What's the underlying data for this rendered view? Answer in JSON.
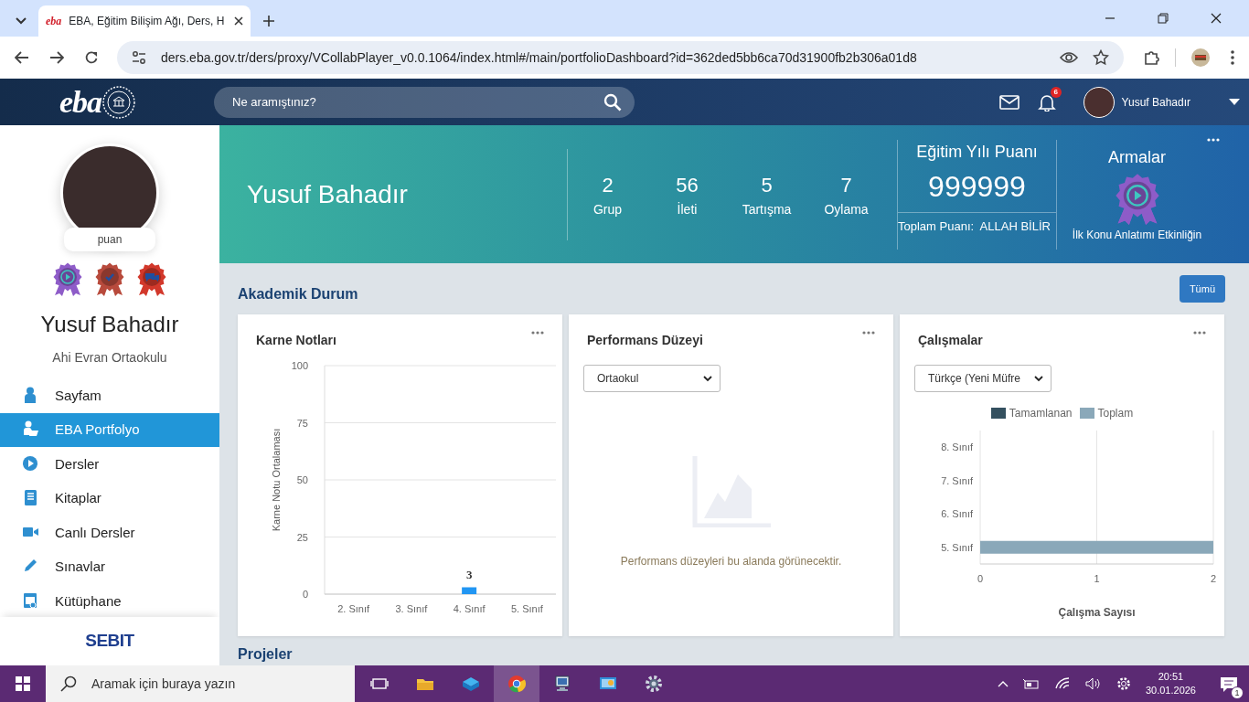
{
  "browser": {
    "favicon_text": "eba",
    "tab_title": "EBA, Eğitim Bilişim Ağı, Ders, H",
    "url": "ders.eba.gov.tr/ders/proxy/VCollabPlayer_v0.0.1064/index.html#/main/portfolioDashboard?id=362ded5bb6ca70d31900fb2b306a01d8"
  },
  "header": {
    "logo": "eba",
    "search": {
      "placeholder": "Ne aramıştınız?"
    },
    "notification_count": "6",
    "user_name": "Yusuf Bahadır"
  },
  "sidebar": {
    "points_label": "puan",
    "badges": [
      {
        "color": "#8e5cc8"
      },
      {
        "color": "#b84a3c"
      },
      {
        "color": "#d2382b"
      }
    ],
    "name": "Yusuf Bahadır",
    "school": "Ahi Evran Ortaokulu",
    "items": [
      {
        "label": "Sayfam",
        "selected": false
      },
      {
        "label": "EBA Portfolyo",
        "selected": true
      },
      {
        "label": "Dersler",
        "selected": false
      },
      {
        "label": "Kitaplar",
        "selected": false
      },
      {
        "label": "Canlı Dersler",
        "selected": false
      },
      {
        "label": "Sınavlar",
        "selected": false
      },
      {
        "label": "Kütüphane",
        "selected": false
      }
    ],
    "footer_logo": "SEBIT"
  },
  "banner": {
    "name": "Yusuf Bahadır",
    "stats": [
      {
        "value": "2",
        "label": "Grup"
      },
      {
        "value": "56",
        "label": "İleti"
      },
      {
        "value": "5",
        "label": "Tartışma"
      },
      {
        "value": "7",
        "label": "Oylama"
      }
    ],
    "year_points_title": "Eğitim Yılı Puanı",
    "year_points": "999999",
    "total_points": "Toplam Puanı:  ALLAH BİLİR",
    "emblems_title": "Armalar",
    "emblem_caption": "İlk Konu Anlatımı Etkinliğin"
  },
  "section": {
    "title": "Akademik Durum",
    "button": "Tümü"
  },
  "cards": [
    {
      "title": "Karne Notları",
      "kind": "chart",
      "chart_data": {
        "type": "bar",
        "ylabel": "Karne Notu Ortalaması",
        "categories": [
          "2. Sınıf",
          "3. Sınıf",
          "4. Sınıf",
          "5. Sınıf"
        ],
        "values": [
          null,
          null,
          3,
          null
        ],
        "grid": true,
        "ylim": [
          0,
          100
        ],
        "yticks": [
          0,
          25,
          50,
          75,
          100
        ],
        "data_labels": true
      }
    },
    {
      "title": "Performans Düzeyi",
      "kind": "empty",
      "select": "Ortaokul",
      "empty_text": "Performans düzeyleri bu alanda görünecektir."
    },
    {
      "title": "Çalışmalar",
      "kind": "chart",
      "select": "Türkçe (Yeni Müfre",
      "chart_data": {
        "type": "bar",
        "orientation": "horizontal",
        "xlabel": "Çalışma Sayısı",
        "categories": [
          "8. Sınıf",
          "7. Sınıf",
          "6. Sınıf",
          "5. Sınıf"
        ],
        "series": [
          {
            "name": "Tamamlanan",
            "color": "#34505f",
            "values": [
              0,
              0,
              0,
              0
            ]
          },
          {
            "name": "Toplam",
            "color": "#8aa8b9",
            "values": [
              0,
              0,
              0,
              2
            ]
          }
        ],
        "grid": true,
        "xlim": [
          0,
          2
        ],
        "xticks": [
          0,
          1,
          2
        ]
      }
    }
  ],
  "next_section": {
    "title": "Projeler"
  },
  "taskbar": {
    "search": {
      "placeholder": "Aramak için buraya yazın"
    },
    "time": "20:51",
    "date": "30.01.2026",
    "notification_count": "1"
  }
}
